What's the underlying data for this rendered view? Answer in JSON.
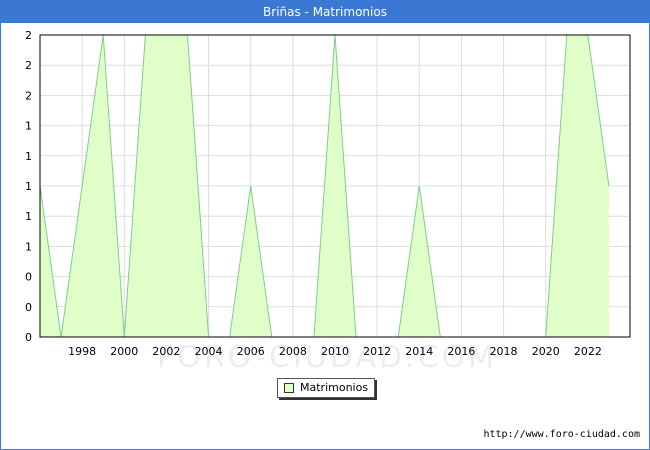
{
  "header": {
    "title": "Briñas - Matrimonios"
  },
  "footer": {
    "url": "http://www.foro-ciudad.com"
  },
  "watermark": {
    "text": "FORO-CIUDAD.COM"
  },
  "colors": {
    "fill": "#e0ffc8",
    "line": "#7fcc8f",
    "grid": "#dddddd",
    "header": "#3a78d4"
  },
  "chart_data": {
    "type": "area",
    "title": "Briñas - Matrimonios",
    "x": [
      1996,
      1997,
      1998,
      1999,
      2000,
      2001,
      2002,
      2003,
      2004,
      2005,
      2006,
      2007,
      2008,
      2009,
      2010,
      2011,
      2012,
      2013,
      2014,
      2015,
      2016,
      2017,
      2018,
      2019,
      2020,
      2021,
      2022,
      2023
    ],
    "series": [
      {
        "name": "Matrimonios",
        "values": [
          1,
          0,
          1,
          2,
          0,
          2,
          2,
          2,
          0,
          0,
          1,
          0,
          0,
          0,
          2,
          0,
          0,
          0,
          1,
          0,
          0,
          0,
          0,
          0,
          0,
          2,
          2,
          1
        ]
      }
    ],
    "x_ticks": [
      1998,
      2000,
      2002,
      2004,
      2006,
      2008,
      2010,
      2012,
      2014,
      2016,
      2018,
      2020,
      2022
    ],
    "x_range": [
      1996,
      2024
    ],
    "y_range": [
      0,
      2
    ],
    "y_tick_labels": [
      "0",
      "0",
      "0",
      "1",
      "1",
      "1",
      "1",
      "1",
      "2",
      "2",
      "2"
    ],
    "grid": true,
    "legend": {
      "position": "bottom-center",
      "entries": [
        "Matrimonios"
      ]
    }
  }
}
